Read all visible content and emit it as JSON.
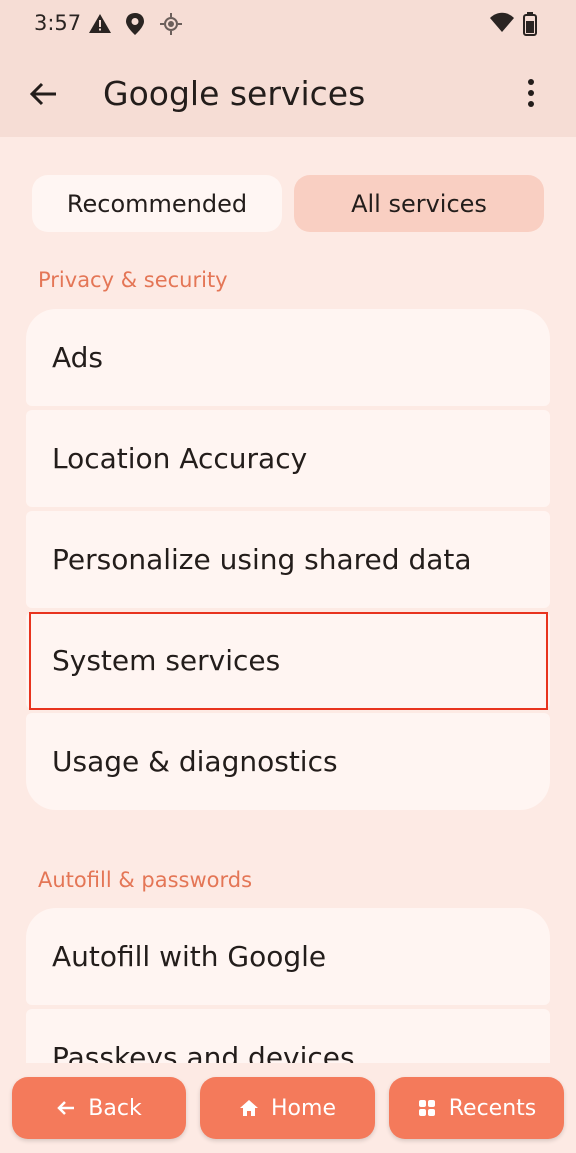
{
  "status_bar": {
    "time": "3:57",
    "icons": [
      "alert-icon",
      "location-pin-icon",
      "gps-icon",
      "wifi-icon",
      "battery-icon"
    ]
  },
  "app_bar": {
    "title": "Google services",
    "back_icon": "back-arrow-icon",
    "menu_icon": "more-vert-icon"
  },
  "tabs": [
    {
      "label": "Recommended",
      "selected": false
    },
    {
      "label": "All services",
      "selected": true
    }
  ],
  "sections": [
    {
      "header": "Privacy & security",
      "items": [
        "Ads",
        "Location Accuracy",
        "Personalize using shared data",
        "System services",
        "Usage & diagnostics"
      ]
    },
    {
      "header": "Autofill & passwords",
      "items": [
        "Autofill with Google",
        "Passkeys and devices"
      ]
    }
  ],
  "nav": {
    "back": "Back",
    "home": "Home",
    "recents": "Recents"
  },
  "colors": {
    "accent": "#f47a5b",
    "section_header": "#e47656",
    "highlight_border": "#e8331e"
  }
}
